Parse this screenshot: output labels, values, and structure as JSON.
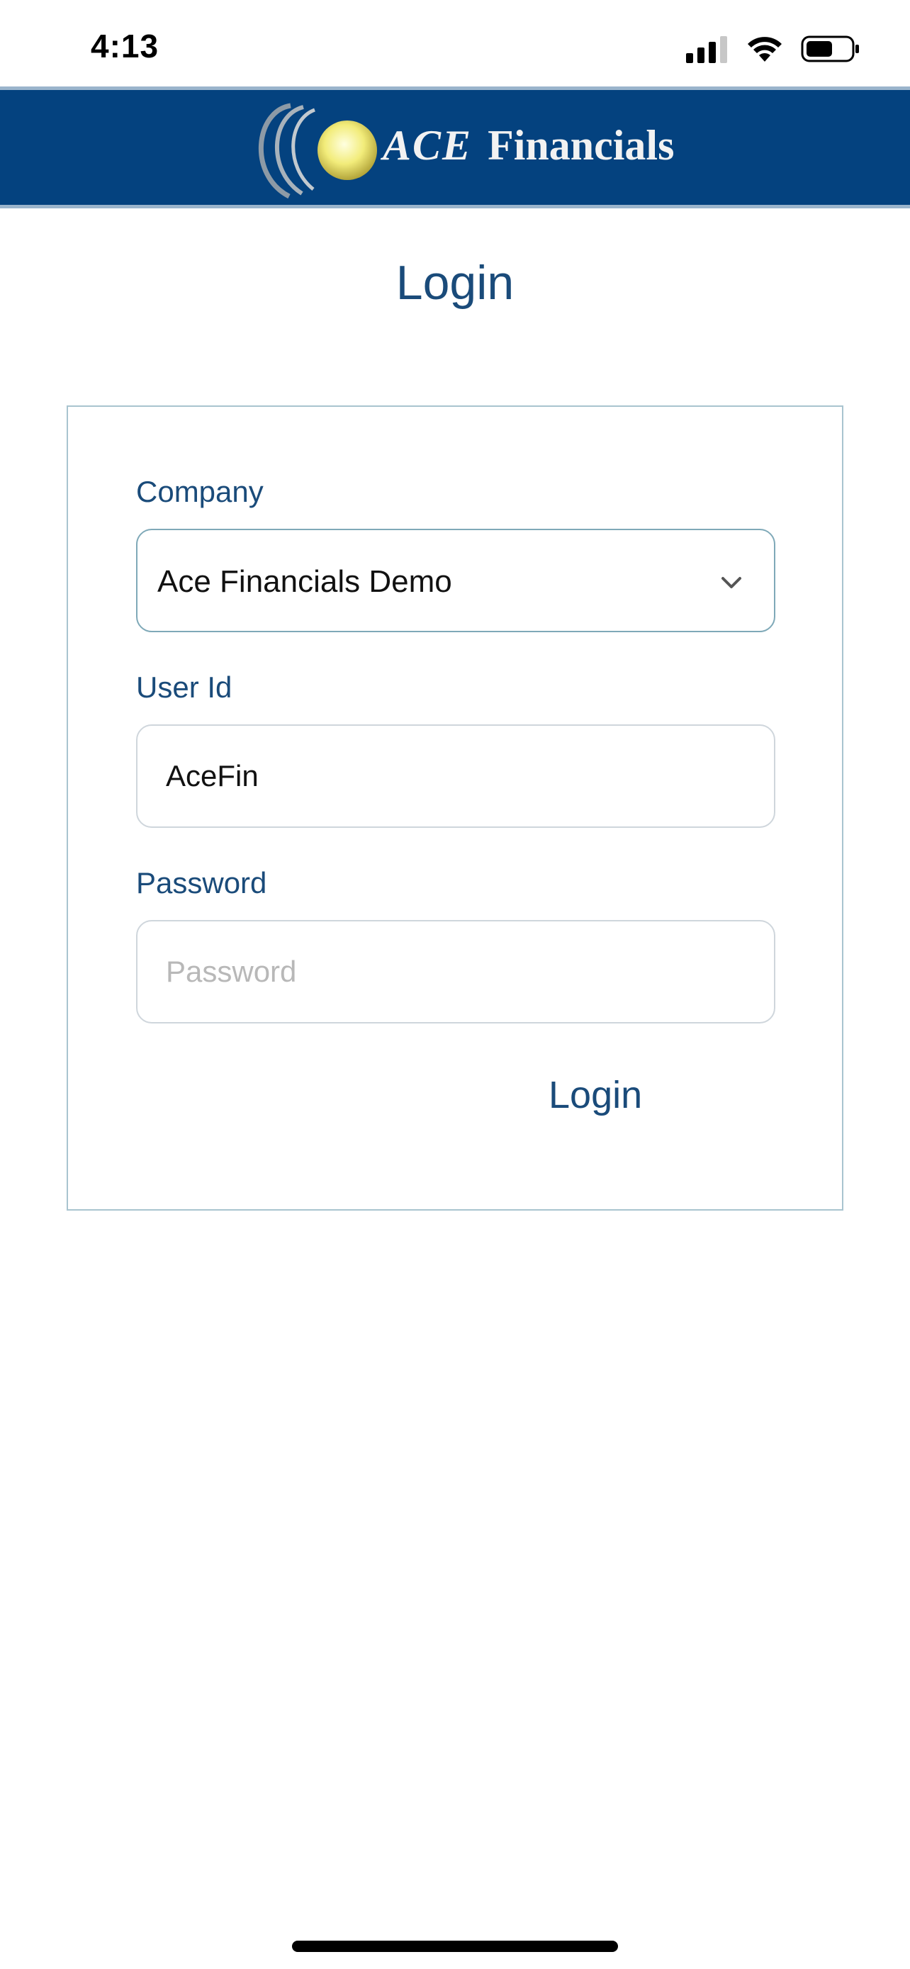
{
  "status_bar": {
    "time": "4:13",
    "icons": [
      "signal-icon",
      "wifi-icon",
      "battery-icon"
    ]
  },
  "brand": {
    "name_ace": "ACE",
    "name_financials": "Financials",
    "colors": {
      "header_bg": "#04427f",
      "logo_sun": "#f2ec7a"
    }
  },
  "page": {
    "title": "Login"
  },
  "form": {
    "company": {
      "label": "Company",
      "selected": "Ace Financials Demo"
    },
    "user_id": {
      "label": "User Id",
      "value": "AceFin"
    },
    "password": {
      "label": "Password",
      "placeholder": "Password",
      "value": ""
    },
    "submit_label": "Login"
  },
  "colors": {
    "accent": "#1a4b7a",
    "card_border": "#a9c4cf"
  }
}
